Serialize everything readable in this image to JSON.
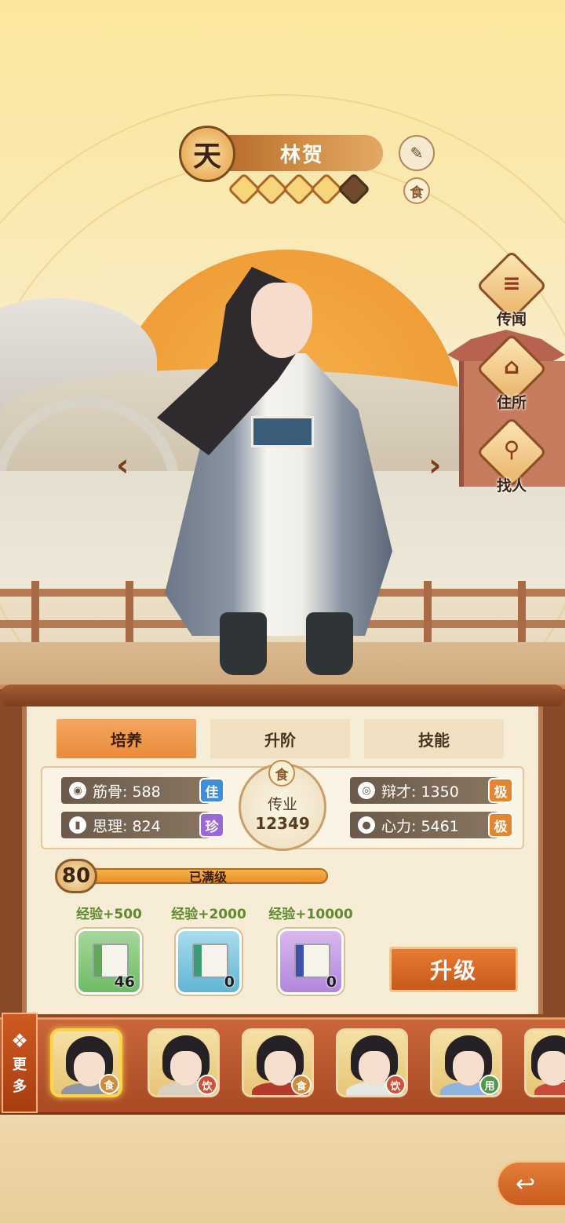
{
  "character": {
    "tier": "天",
    "name": "林贺",
    "stars_filled": 4,
    "stars_total": 5,
    "type_tag": "食"
  },
  "side_menu": [
    {
      "label": "传闻",
      "icon": "scroll-icon"
    },
    {
      "label": "住所",
      "icon": "house-icon"
    },
    {
      "label": "找人",
      "icon": "search-person-icon"
    }
  ],
  "tabs": [
    "培养",
    "升阶",
    "技能"
  ],
  "stats": {
    "jin_gu": {
      "label": "筋骨: 588",
      "grade": "佳"
    },
    "si_li": {
      "label": "思理: 824",
      "grade": "珍"
    },
    "bian_cai": {
      "label": "辩才: 1350",
      "grade": "极"
    },
    "xin_li": {
      "label": "心力: 5461",
      "grade": "极"
    },
    "center": {
      "tag": "食",
      "label": "传业",
      "value": "12349"
    }
  },
  "level": {
    "value": "80",
    "status": "已满级",
    "progress": 1.0
  },
  "exp_items": [
    {
      "label": "经验+500",
      "count": "46",
      "color": "green"
    },
    {
      "label": "经验+2000",
      "count": "0",
      "color": "blue"
    },
    {
      "label": "经验+10000",
      "count": "0",
      "color": "purple"
    }
  ],
  "upgrade_label": "升级",
  "more_label_1": "更",
  "more_label_2": "多",
  "roster": [
    {
      "tag": "食",
      "tag_type": "food",
      "selected": true
    },
    {
      "tag": "饮",
      "tag_type": "drink",
      "selected": false
    },
    {
      "tag": "食",
      "tag_type": "food",
      "selected": false
    },
    {
      "tag": "饮",
      "tag_type": "drink",
      "selected": false
    },
    {
      "tag": "用",
      "tag_type": "use",
      "selected": false
    },
    {
      "tag": "",
      "tag_type": "drink",
      "selected": false
    }
  ],
  "colors": {
    "accent": "#e98a3a",
    "panel": "#f7ecd6",
    "frame": "#8a4a2a"
  }
}
